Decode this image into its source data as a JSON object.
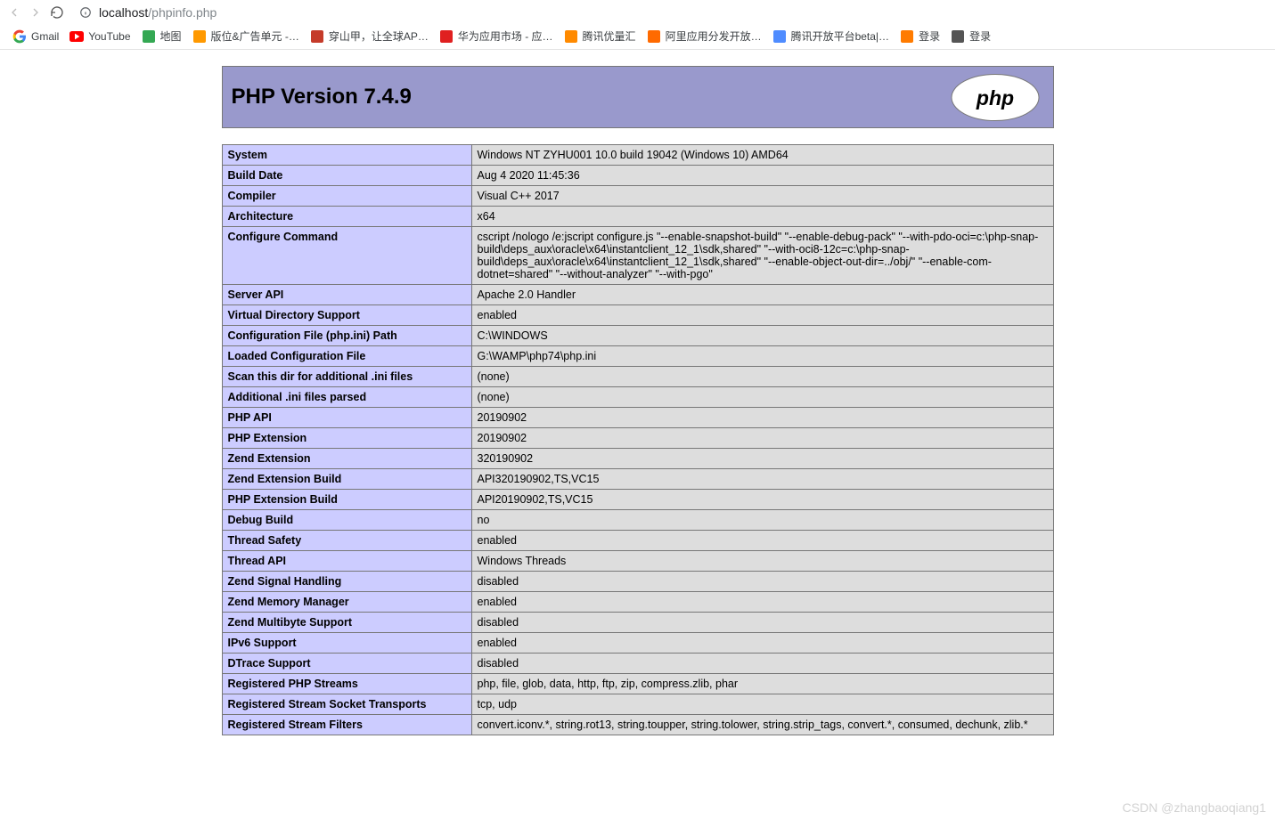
{
  "browser": {
    "url_prefix": "localhost",
    "url_path": "/phpinfo.php"
  },
  "bookmarks": [
    {
      "label": "Gmail",
      "color": "#ea4335"
    },
    {
      "label": "YouTube",
      "color": "#ff0000"
    },
    {
      "label": "地图",
      "color": "#34a853"
    },
    {
      "label": "版位&广告单元 -…",
      "color": "#ff9900"
    },
    {
      "label": "穿山甲，让全球AP…",
      "color": "#c53b2a"
    },
    {
      "label": "华为应用市场 - 应…",
      "color": "#e02020"
    },
    {
      "label": "腾讯优量汇",
      "color": "#ff8a00"
    },
    {
      "label": "阿里应用分发开放…",
      "color": "#ff6a00"
    },
    {
      "label": "腾讯开放平台beta|…",
      "color": "#4f8cff"
    },
    {
      "label": "登录",
      "color": "#ff7b00"
    },
    {
      "label": "登录",
      "color": "#555"
    }
  ],
  "php": {
    "title": "PHP Version 7.4.9"
  },
  "rows": [
    {
      "k": "System",
      "v": "Windows NT ZYHU001 10.0 build 19042 (Windows 10) AMD64"
    },
    {
      "k": "Build Date",
      "v": "Aug 4 2020 11:45:36"
    },
    {
      "k": "Compiler",
      "v": "Visual C++ 2017"
    },
    {
      "k": "Architecture",
      "v": "x64"
    },
    {
      "k": "Configure Command",
      "v": "cscript /nologo /e:jscript configure.js \"--enable-snapshot-build\" \"--enable-debug-pack\" \"--with-pdo-oci=c:\\php-snap-build\\deps_aux\\oracle\\x64\\instantclient_12_1\\sdk,shared\" \"--with-oci8-12c=c:\\php-snap-build\\deps_aux\\oracle\\x64\\instantclient_12_1\\sdk,shared\" \"--enable-object-out-dir=../obj/\" \"--enable-com-dotnet=shared\" \"--without-analyzer\" \"--with-pgo\""
    },
    {
      "k": "Server API",
      "v": "Apache 2.0 Handler"
    },
    {
      "k": "Virtual Directory Support",
      "v": "enabled"
    },
    {
      "k": "Configuration File (php.ini) Path",
      "v": "C:\\WINDOWS"
    },
    {
      "k": "Loaded Configuration File",
      "v": "G:\\WAMP\\php74\\php.ini"
    },
    {
      "k": "Scan this dir for additional .ini files",
      "v": "(none)"
    },
    {
      "k": "Additional .ini files parsed",
      "v": "(none)"
    },
    {
      "k": "PHP API",
      "v": "20190902"
    },
    {
      "k": "PHP Extension",
      "v": "20190902"
    },
    {
      "k": "Zend Extension",
      "v": "320190902"
    },
    {
      "k": "Zend Extension Build",
      "v": "API320190902,TS,VC15"
    },
    {
      "k": "PHP Extension Build",
      "v": "API20190902,TS,VC15"
    },
    {
      "k": "Debug Build",
      "v": "no"
    },
    {
      "k": "Thread Safety",
      "v": "enabled"
    },
    {
      "k": "Thread API",
      "v": "Windows Threads"
    },
    {
      "k": "Zend Signal Handling",
      "v": "disabled"
    },
    {
      "k": "Zend Memory Manager",
      "v": "enabled"
    },
    {
      "k": "Zend Multibyte Support",
      "v": "disabled"
    },
    {
      "k": "IPv6 Support",
      "v": "enabled"
    },
    {
      "k": "DTrace Support",
      "v": "disabled"
    },
    {
      "k": "Registered PHP Streams",
      "v": "php, file, glob, data, http, ftp, zip, compress.zlib, phar"
    },
    {
      "k": "Registered Stream Socket Transports",
      "v": "tcp, udp"
    },
    {
      "k": "Registered Stream Filters",
      "v": "convert.iconv.*, string.rot13, string.toupper, string.tolower, string.strip_tags, convert.*, consumed, dechunk, zlib.*"
    }
  ],
  "watermark": "CSDN @zhangbaoqiang1"
}
